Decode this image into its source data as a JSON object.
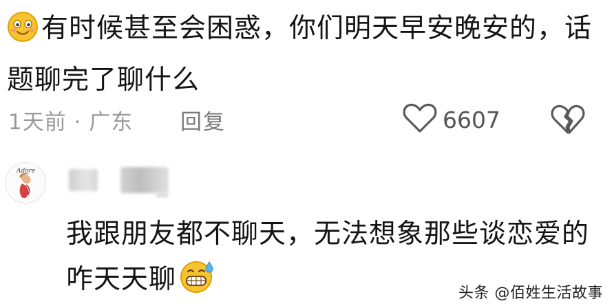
{
  "comment1": {
    "emoji": "smiling-face-emoji",
    "text": "有时候甚至会困惑，你们明天早安晚安的，话题聊完了聊什么",
    "time": "1天前",
    "separator": "·",
    "location": "广东",
    "reply_label": "回复",
    "like_count": "6607"
  },
  "comment2": {
    "avatar_text": "Adore",
    "text": "我跟朋友都不聊天，无法想象那些谈恋爱的咋天天聊",
    "emoji": "grinning-sweat-emoji"
  },
  "watermark": "头条 @佰姓生活故事",
  "colors": {
    "text": "#141414",
    "meta": "#9a9a9a",
    "emoji_yellow": "#f6c431",
    "emoji_outline": "#e0a000"
  }
}
